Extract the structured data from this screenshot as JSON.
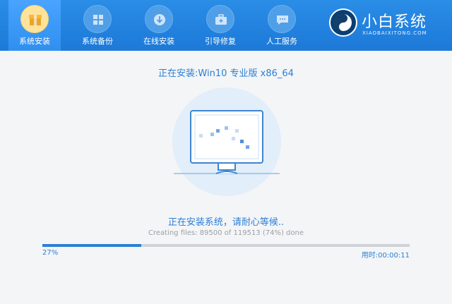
{
  "nav": {
    "items": [
      {
        "label": "系统安装",
        "icon": "box-icon",
        "active": true
      },
      {
        "label": "系统备份",
        "icon": "windows-icon",
        "active": false
      },
      {
        "label": "在线安装",
        "icon": "download-icon",
        "active": false
      },
      {
        "label": "引导修复",
        "icon": "toolbox-icon",
        "active": false
      },
      {
        "label": "人工服务",
        "icon": "chat-icon",
        "active": false
      }
    ]
  },
  "brand": {
    "title": "小白系统",
    "subtitle": "XIAOBAIXITONG.COM"
  },
  "install": {
    "title": "正在安装:Win10 专业版 x86_64",
    "status": "正在安装系统，请耐心等候..",
    "detail": "Creating files: 89500 of 119513 (74%) done",
    "progress_fraction": 0.27,
    "progress_label": "27%",
    "elapsed_label": "用时:00:00:11"
  },
  "colors": {
    "header": "#1d79d8",
    "accent": "#2a7fd4",
    "active_icon": "#ffe39a"
  }
}
